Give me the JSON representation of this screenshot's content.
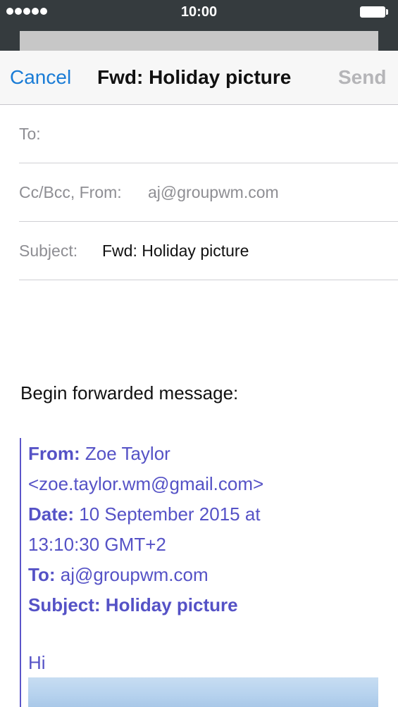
{
  "status_bar": {
    "time": "10:00"
  },
  "nav": {
    "cancel_label": "Cancel",
    "title": "Fwd: Holiday picture",
    "send_label": "Send"
  },
  "fields": {
    "to_label": "To:",
    "ccbcc_label": "Cc/Bcc, From:",
    "from_value": "aj@groupwm.com",
    "subject_label": "Subject:",
    "subject_value": "Fwd: Holiday picture"
  },
  "body": {
    "intro": "Begin forwarded message:",
    "forwarded": {
      "from_label": "From:",
      "from_name": "Zoe Taylor",
      "from_email": "<zoe.taylor.wm@gmail.com>",
      "date_label": "Date:",
      "date_value_line1": "10 September 2015 at",
      "date_value_line2": "13:10:30 GMT+2",
      "to_label": "To:",
      "to_value": "aj@groupwm.com",
      "subject_line": "Subject: Holiday picture",
      "greeting": "Hi"
    }
  },
  "colors": {
    "status_bar_bg": "#353b3e",
    "link_blue": "#1a7cd6",
    "quote_purple": "#5552c6"
  }
}
